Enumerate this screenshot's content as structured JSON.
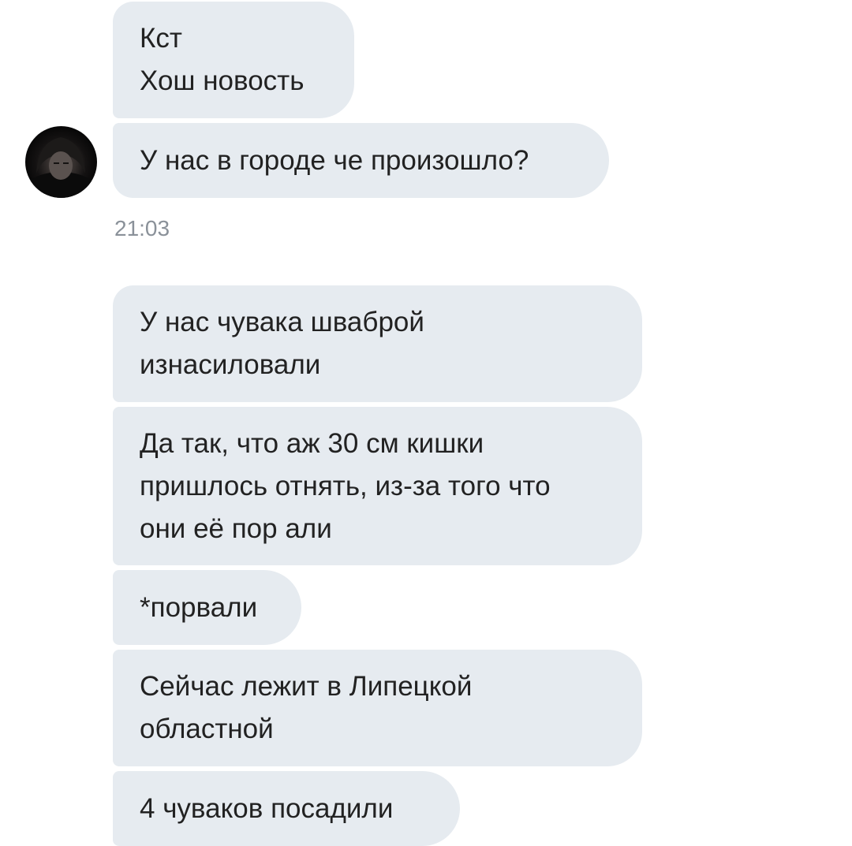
{
  "conversation": {
    "group_one": {
      "messages": [
        {
          "text": "Кст\nХош новость"
        },
        {
          "text": "У нас в городе че произошло?"
        }
      ],
      "timestamp": "21:03"
    },
    "group_two": {
      "messages": [
        {
          "text": "У нас чувака шваброй\nизнасиловали"
        },
        {
          "text": "Да так, что аж 30 см кишки\nпришлось отнять, из-за того что\nони её пор али"
        },
        {
          "text": "*порвали"
        },
        {
          "text": "Сейчас лежит в Липецкой\nобластной"
        },
        {
          "text": "4 чуваков посадили"
        }
      ]
    }
  },
  "colors": {
    "bubble_bg": "#e6ebf0",
    "text": "#222222",
    "timestamp": "#8a9199"
  },
  "icons": {
    "avatar": "user-avatar-dark-hooded-figure"
  }
}
